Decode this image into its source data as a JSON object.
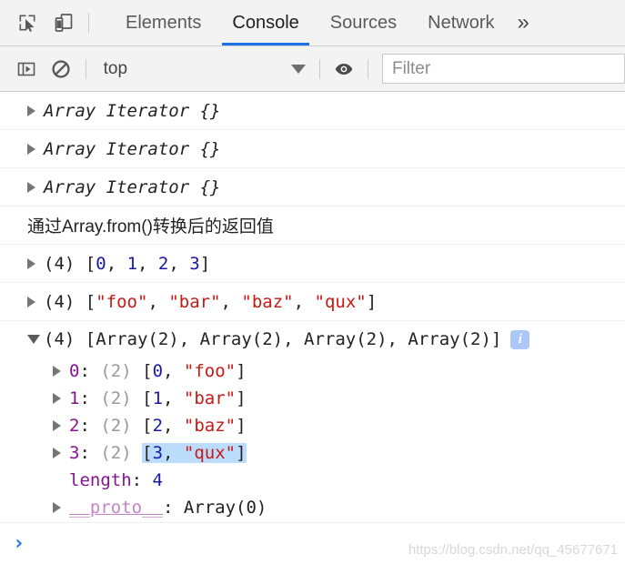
{
  "tabbar": {
    "icons": [
      {
        "name": "inspect-element-icon",
        "label": "Inspect element"
      },
      {
        "name": "device-toolbar-icon",
        "label": "Toggle device toolbar"
      }
    ],
    "tabs": [
      {
        "label": "Elements",
        "active": false
      },
      {
        "label": "Console",
        "active": true
      },
      {
        "label": "Sources",
        "active": false
      },
      {
        "label": "Network",
        "active": false
      }
    ],
    "more_label": "»"
  },
  "console_toolbar": {
    "sidebar_toggle_label": "Show console sidebar",
    "clear_label": "Clear console",
    "context_selected": "top",
    "eye_label": "Create live expression",
    "filter_placeholder": "Filter",
    "filter_value": ""
  },
  "console": {
    "messages": [
      {
        "type": "object",
        "disclosure": "closed",
        "text": "Array Iterator {}",
        "italic": true
      },
      {
        "type": "object",
        "disclosure": "closed",
        "text": "Array Iterator {}",
        "italic": true
      },
      {
        "type": "object",
        "disclosure": "closed",
        "text": "Array Iterator {}",
        "italic": true
      },
      {
        "type": "text",
        "disclosure": "none",
        "text": "通过Array.from()转换后的返回值",
        "italic": false
      }
    ],
    "array_numbers": {
      "count": "(4)",
      "open_bracket": "[",
      "items": [
        "0",
        "1",
        "2",
        "3"
      ],
      "separator": ", ",
      "close_bracket": "]"
    },
    "array_strings": {
      "count": "(4)",
      "open_bracket": "[",
      "items": [
        "\"foo\"",
        "\"bar\"",
        "\"baz\"",
        "\"qux\""
      ],
      "separator": ", ",
      "close_bracket": "]"
    },
    "expanded_array": {
      "count": "(4)",
      "preview": "[Array(2), Array(2), Array(2), Array(2)]",
      "info_badge": "i",
      "properties": [
        {
          "key": "0",
          "size": "(2)",
          "num": "0",
          "str": "\"foo\"",
          "highlight": false
        },
        {
          "key": "1",
          "size": "(2)",
          "num": "1",
          "str": "\"bar\"",
          "highlight": false
        },
        {
          "key": "2",
          "size": "(2)",
          "num": "2",
          "str": "\"baz\"",
          "highlight": false
        },
        {
          "key": "3",
          "size": "(2)",
          "num": "3",
          "str": "\"qux\"",
          "highlight": true
        }
      ],
      "length_key": "length",
      "length_value": "4",
      "proto_key": "__proto__",
      "proto_value": "Array(0)"
    }
  },
  "prompt": {
    "caret": "›"
  },
  "watermark": "https://blog.csdn.net/qq_45677671",
  "colors": {
    "accent": "#1a73e8",
    "number": "#1a1aa6",
    "string": "#c41a16",
    "property": "#881391",
    "proto": "#c485c4",
    "selection": "#bcdcfc",
    "chrome_bg": "#f3f3f3"
  }
}
